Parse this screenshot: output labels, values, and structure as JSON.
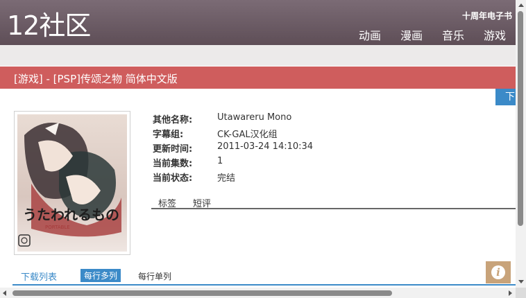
{
  "header": {
    "logo": "12社区",
    "promo": "十周年电子书",
    "nav": [
      "动画",
      "漫画",
      "音乐",
      "游戏"
    ]
  },
  "title": "[游戏] - [PSP]传颂之物 简体中文版",
  "download_tab": "下",
  "cover": {
    "title_art": "うたわれるもの",
    "subtitle_art": "PORTABLE"
  },
  "info": [
    {
      "label": "其他名称:",
      "value": "Utawareru Mono"
    },
    {
      "label": "字幕组:",
      "value": "CK-GAL汉化组"
    },
    {
      "label": "更新时间:",
      "value": "2011-03-24 14:10:34"
    },
    {
      "label": "当前集数:",
      "value": "1"
    },
    {
      "label": "当前状态:",
      "value": "完结"
    }
  ],
  "tabs": [
    "标签",
    "短评"
  ],
  "download_list": {
    "title": "下载列表",
    "view_multi": "每行多列",
    "view_single": "每行单列"
  },
  "info_button": "i",
  "colors": {
    "header": "#6c5c66",
    "title_bar": "#cf5d5d",
    "accent": "#3b8ac8",
    "info_button": "#c8a37a"
  }
}
